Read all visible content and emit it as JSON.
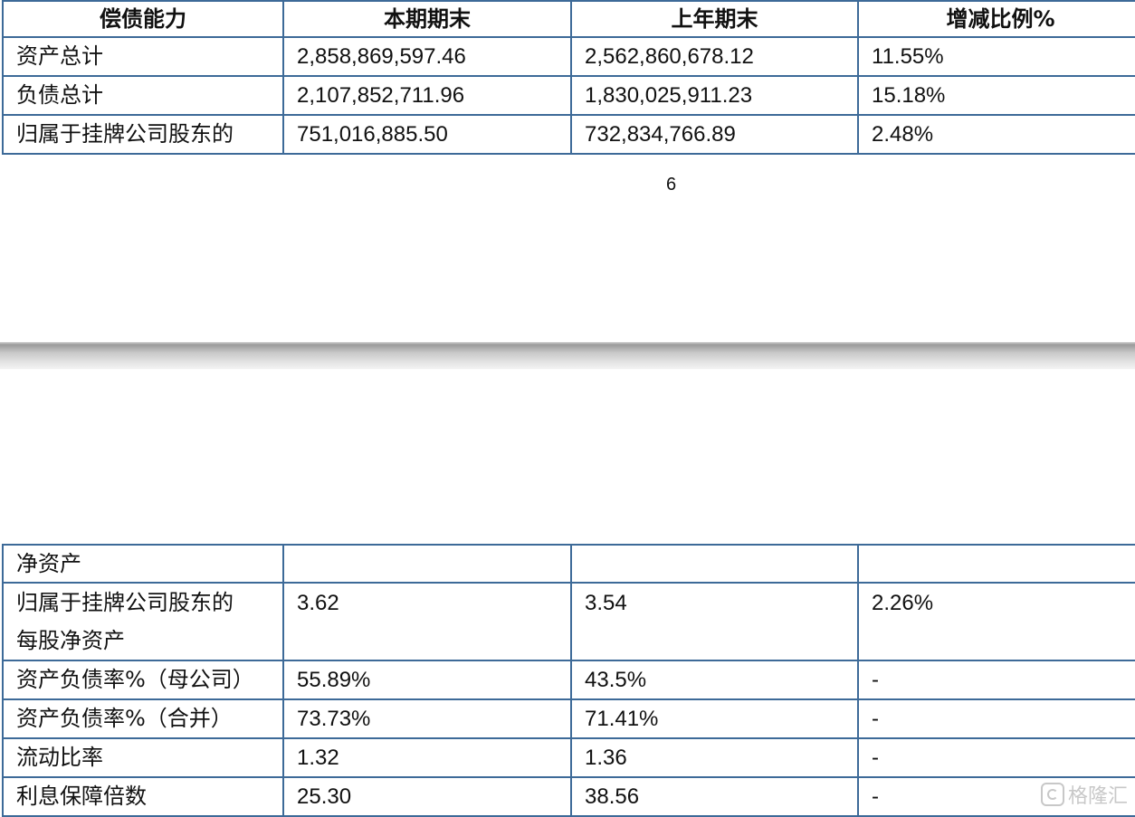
{
  "top_table": {
    "headers": [
      "偿债能力",
      "本期期末",
      "上年期末",
      "增减比例%"
    ],
    "rows": [
      [
        "资产总计",
        "2,858,869,597.46",
        "2,562,860,678.12",
        "11.55%"
      ],
      [
        "负债总计",
        "2,107,852,711.96",
        "1,830,025,911.23",
        "15.18%"
      ],
      [
        "归属于挂牌公司股东的",
        "751,016,885.50",
        "732,834,766.89",
        "2.48%"
      ]
    ]
  },
  "page_number": "6",
  "bottom_table": {
    "rows": [
      [
        "净资产",
        "",
        "",
        ""
      ],
      [
        "归属于挂牌公司股东的",
        "3.62",
        "3.54",
        "2.26%"
      ],
      [
        "资产负债率%（母公司）",
        "55.89%",
        "43.5%",
        "-"
      ],
      [
        "资产负债率%（合并）",
        "73.73%",
        "71.41%",
        "-"
      ],
      [
        "流动比率",
        "1.32",
        "1.36",
        "-"
      ],
      [
        "利息保障倍数",
        "25.30",
        "38.56",
        "-"
      ]
    ],
    "row2_label_line2": "每股净资产"
  },
  "watermark": {
    "icon": "gelonghui-logo-icon",
    "text": "格隆汇"
  }
}
